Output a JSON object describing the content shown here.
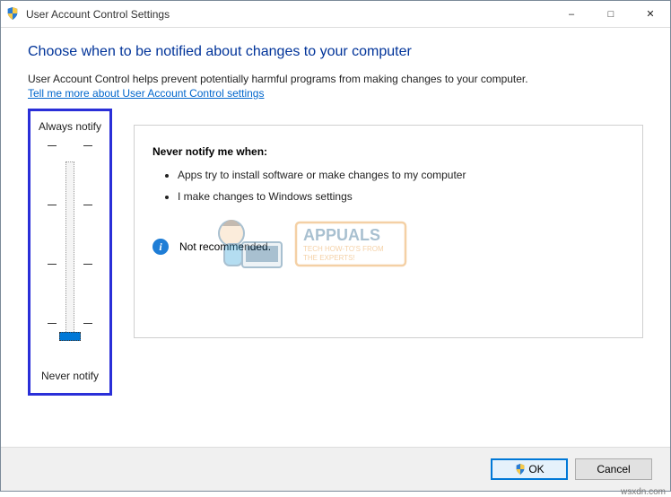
{
  "titlebar": {
    "title": "User Account Control Settings"
  },
  "content": {
    "heading": "Choose when to be notified about changes to your computer",
    "subtext": "User Account Control helps prevent potentially harmful programs from making changes to your computer.",
    "link": "Tell me more about User Account Control settings"
  },
  "slider": {
    "top_label": "Always notify",
    "bottom_label": "Never notify"
  },
  "panel": {
    "title": "Never notify me when:",
    "items": [
      "Apps try to install software or make changes to my computer",
      "I make changes to Windows settings"
    ],
    "recommend": "Not recommended."
  },
  "footer": {
    "ok": "OK",
    "cancel": "Cancel"
  },
  "watermark": {
    "brand": "APPUALS",
    "tag1": "TECH HOW-TO'S FROM",
    "tag2": "THE EXPERTS!"
  },
  "corner": "wsxdn.com"
}
